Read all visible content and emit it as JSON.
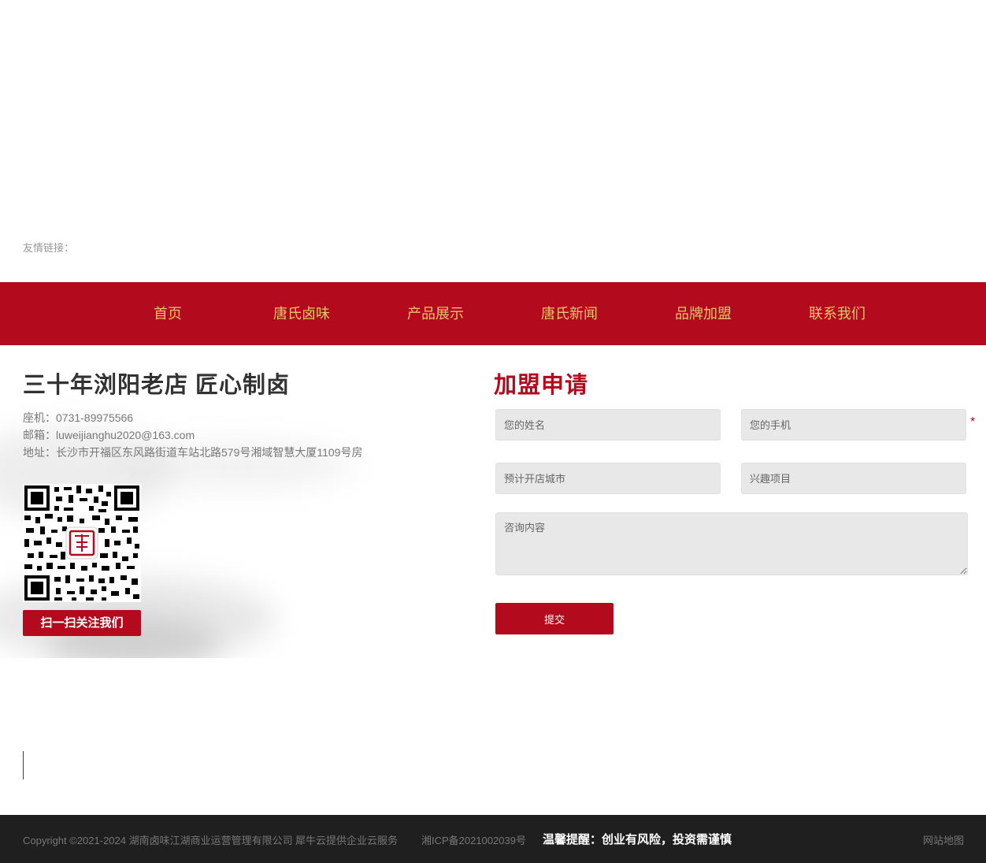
{
  "friend_links": {
    "label": "友情链接："
  },
  "nav": {
    "items": [
      {
        "label": "首页"
      },
      {
        "label": "唐氏卤味"
      },
      {
        "label": "产品展示"
      },
      {
        "label": "唐氏新闻"
      },
      {
        "label": "品牌加盟"
      },
      {
        "label": "联系我们"
      }
    ]
  },
  "contact": {
    "slogan": "三十年浏阳老店  匠心制卤",
    "phone": "座机：0731-89975566",
    "email": "邮箱：luweijianghu2020@163.com",
    "address": "地址：长沙市开福区东风路街道车站北路579号湘域智慧大厦1109号房",
    "qr_button": "扫一扫关注我们"
  },
  "form": {
    "title": "加盟申请",
    "name_placeholder": "您的姓名",
    "phone_placeholder": "您的手机",
    "city_placeholder": "预计开店城市",
    "project_placeholder": "兴趣项目",
    "content_placeholder": "咨询内容",
    "required_mark": "*",
    "submit_label": "提交"
  },
  "footer": {
    "copyright": "Copyright ©2021-2024 湖南卤味江湖商业运营管理有限公司",
    "cloud": "犀牛云提供企业云服务",
    "icp": "湘ICP备2021002039号",
    "warning": "温馨提醒：创业有风险，投资需谨慎",
    "sitemap": "网站地图"
  },
  "colors": {
    "brand_red": "#b30a1e",
    "nav_text": "#e9c46a",
    "footer_bg": "#1f1f1f"
  }
}
